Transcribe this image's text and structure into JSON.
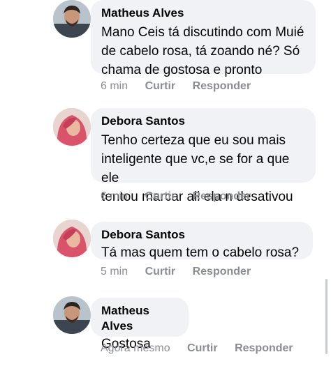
{
  "comments": [
    {
      "author": "Matheus Alves",
      "lines": [
        "Mano Ceis tá discutindo com Muié",
        "de cabelo rosa, tá zoando né? Só",
        "chama de gostosa e pronto"
      ],
      "time": "6 min",
      "like_label": "Curtir",
      "reply_label": "Responder",
      "avatar_icon": "male-profile-photo-icon"
    },
    {
      "author": "Debora Santos",
      "lines": [
        "Tenho certeza que eu sou mais",
        "inteligente que vc,e se for a que ele",
        "tentou marcar ali ela n desativou"
      ],
      "time": "6 min",
      "like_label": "Curtir",
      "reply_label": "Responder",
      "avatar_icon": "female-pink-hair-profile-photo-icon"
    },
    {
      "author": "Debora Santos",
      "lines": [
        "Tá mas quem tem o cabelo rosa?"
      ],
      "time": "5 min",
      "like_label": "Curtir",
      "reply_label": "Responder",
      "avatar_icon": "female-pink-hair-profile-photo-icon"
    },
    {
      "author": "Matheus Alves",
      "lines": [
        "Gostosa"
      ],
      "time": "Agora mesmo",
      "like_label": "Curtir",
      "reply_label": "Responder",
      "avatar_icon": "male-profile-photo-icon"
    }
  ],
  "colors": {
    "bubble": "#f0f2f5",
    "meta_text": "#8a8d91",
    "pink_hair": "#d9536b"
  }
}
